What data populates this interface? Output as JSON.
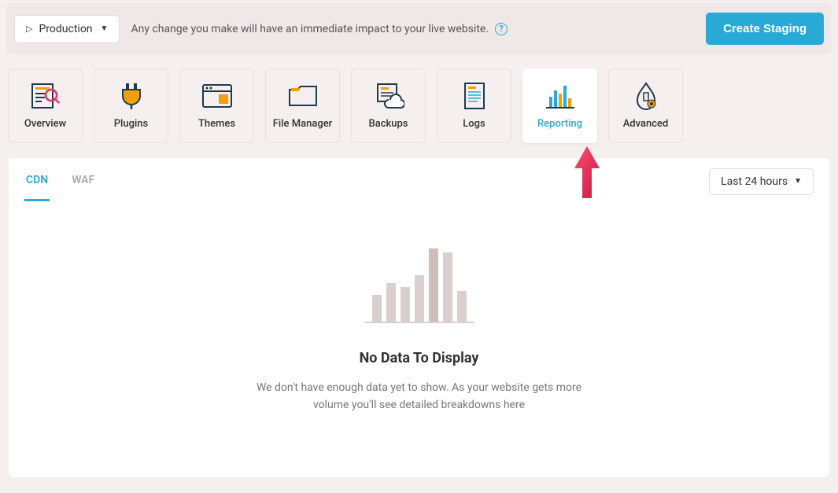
{
  "topbar": {
    "env_label": "Production",
    "message": "Any change you make will have an immediate impact to your live website.",
    "create_staging": "Create Staging"
  },
  "nav": {
    "items": [
      {
        "key": "overview",
        "label": "Overview",
        "active": false
      },
      {
        "key": "plugins",
        "label": "Plugins",
        "active": false
      },
      {
        "key": "themes",
        "label": "Themes",
        "active": false
      },
      {
        "key": "file-manager",
        "label": "File Manager",
        "active": false
      },
      {
        "key": "backups",
        "label": "Backups",
        "active": false
      },
      {
        "key": "logs",
        "label": "Logs",
        "active": false
      },
      {
        "key": "reporting",
        "label": "Reporting",
        "active": true
      },
      {
        "key": "advanced",
        "label": "Advanced",
        "active": false
      }
    ]
  },
  "subtabs": {
    "items": [
      {
        "key": "cdn",
        "label": "CDN",
        "active": true
      },
      {
        "key": "waf",
        "label": "WAF",
        "active": false
      }
    ]
  },
  "range": {
    "selected": "Last 24 hours"
  },
  "empty_state": {
    "title": "No Data To Display",
    "description": "We don't have enough data yet to show. As your website gets more volume you'll see detailed breakdowns here"
  },
  "colors": {
    "accent": "#29a9d6",
    "orange": "#f59e0b",
    "pink_arrow": "#e6306f"
  }
}
